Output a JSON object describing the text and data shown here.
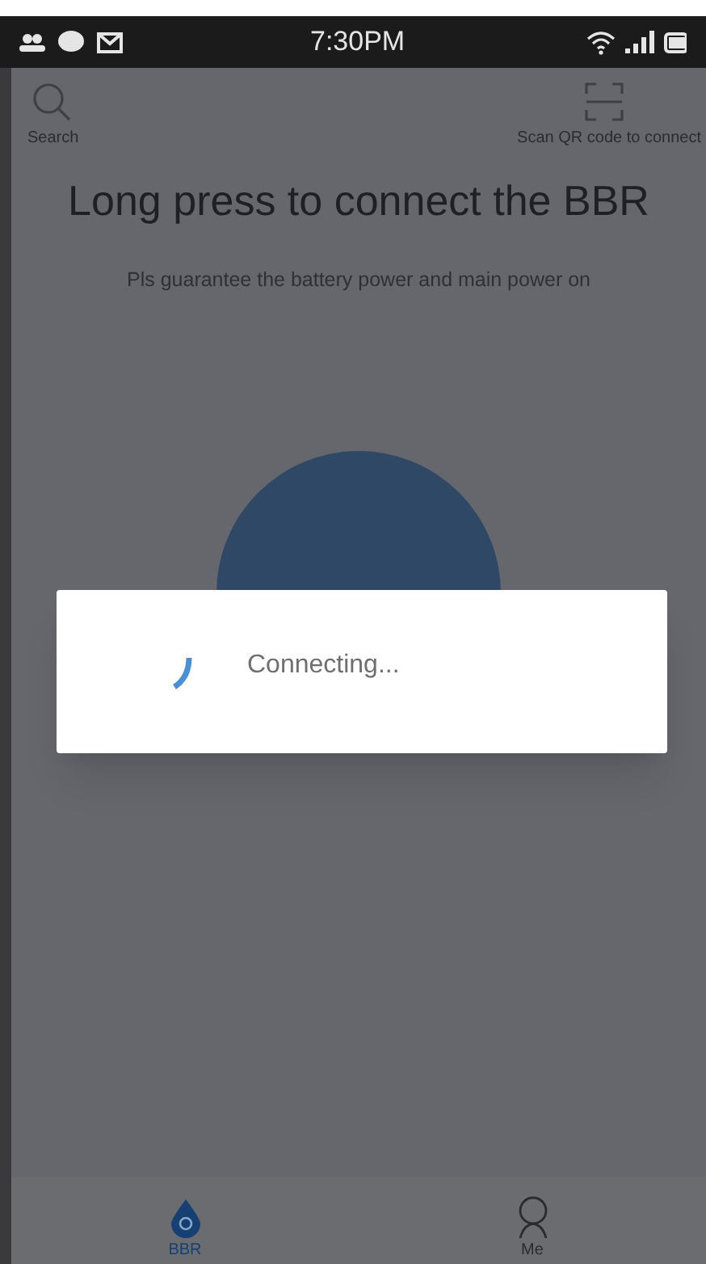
{
  "status_bar": {
    "time": "7:30PM"
  },
  "toolbar": {
    "search_label": "Search",
    "scan_label": "Scan QR code to connect"
  },
  "title": "Long press to connect the BBR",
  "subtitle": "Pls guarantee the battery power and main power on",
  "dialog": {
    "message": "Connecting..."
  },
  "tabs": [
    {
      "label": "BBR",
      "kind": "drop",
      "selected": true
    },
    {
      "label": "Me",
      "kind": "person",
      "selected": false
    }
  ]
}
